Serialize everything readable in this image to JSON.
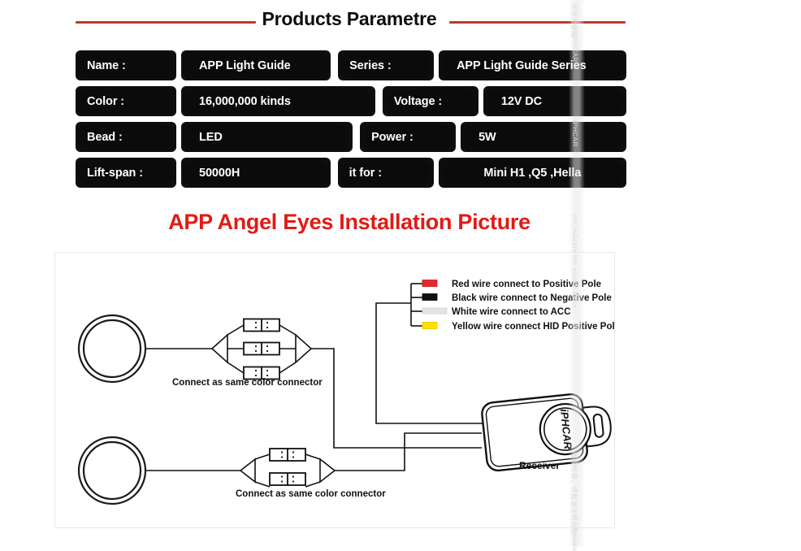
{
  "header": {
    "title": "Products Parametre",
    "rule_color": "#bd3a2c"
  },
  "spec_table": {
    "rows": [
      {
        "key_left": "Name :",
        "val_left": "APP Light Guide",
        "key_right": "Series :",
        "val_right": "APP Light Guide Series"
      },
      {
        "key_left": "Color :",
        "val_left": "16,000,000 kinds",
        "key_right": "Voltage :",
        "val_right": "12V DC"
      },
      {
        "key_left": "Bead :",
        "val_left": "LED",
        "key_right": "Power :",
        "val_right": "5W"
      },
      {
        "key_left": "Lift-span :",
        "val_left": "50000H",
        "key_right": "it for :",
        "val_right": "Mini H1 ,Q5 ,Hella"
      }
    ]
  },
  "section": {
    "heading": "APP Angel Eyes Installation Picture",
    "heading_color": "#e01b16"
  },
  "diagram": {
    "wire_legend": [
      {
        "label": "Red wire connect to Positive Pole",
        "color": "#e8262a"
      },
      {
        "label": "Black wire connect to Negative Pole",
        "color": "#111111"
      },
      {
        "label": "White wire connect to ACC",
        "color": "#e4e4e4"
      },
      {
        "label": "Yellow wire connect HID Positive Pole",
        "color": "#ffe000"
      }
    ],
    "connector_caption_top": "Connect as same color connector",
    "connector_caption_bottom": "Connect as same color connector",
    "receiver_label": "Receiver",
    "receiver_logo": "iPHCAR",
    "top_connector_count": "3",
    "bottom_connector_count": "2"
  },
  "watermarks": {
    "brand": "iPHCAR",
    "cn_1": "光导天使眼",
    "line_1": "und,indicate the source befor",
    "line_2": "版权所有，转载请注明出处",
    "line_3": "Alibaba"
  }
}
